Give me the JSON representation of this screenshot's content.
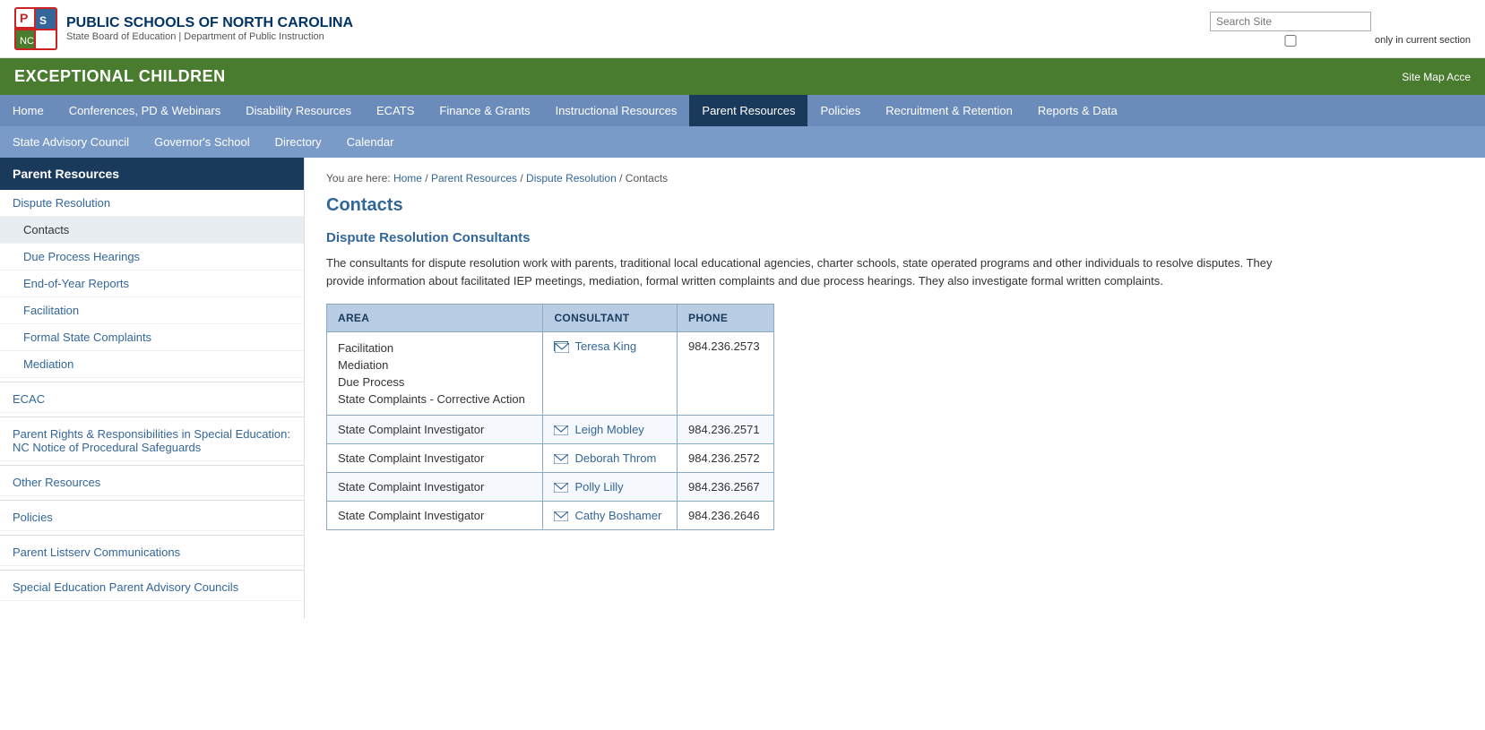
{
  "site": {
    "org_name": "PUBLIC SCHOOLS OF NORTH CAROLINA",
    "org_sub": "State Board of Education | Department of Public Instruction",
    "section": "EXCEPTIONAL CHILDREN",
    "banner_links": "Site Map  Acce"
  },
  "search": {
    "placeholder": "Search Site",
    "checkbox_label": "only in current section"
  },
  "nav": {
    "row1": [
      {
        "label": "Home",
        "active": false
      },
      {
        "label": "Conferences, PD & Webinars",
        "active": false
      },
      {
        "label": "Disability Resources",
        "active": false
      },
      {
        "label": "ECATS",
        "active": false
      },
      {
        "label": "Finance & Grants",
        "active": false
      },
      {
        "label": "Instructional Resources",
        "active": false
      },
      {
        "label": "Parent Resources",
        "active": true
      },
      {
        "label": "Policies",
        "active": false
      },
      {
        "label": "Recruitment & Retention",
        "active": false
      },
      {
        "label": "Reports & Data",
        "active": false
      }
    ],
    "row2": [
      {
        "label": "State Advisory Council",
        "active": false
      },
      {
        "label": "Governor's School",
        "active": false
      },
      {
        "label": "Directory",
        "active": false
      },
      {
        "label": "Calendar",
        "active": false
      }
    ]
  },
  "sidebar": {
    "title": "Parent Resources",
    "items": [
      {
        "label": "Dispute Resolution",
        "level": "top",
        "active": false
      },
      {
        "label": "Contacts",
        "level": "indented",
        "active": true
      },
      {
        "label": "Due Process Hearings",
        "level": "indented",
        "active": false
      },
      {
        "label": "End-of-Year Reports",
        "level": "indented",
        "active": false
      },
      {
        "label": "Facilitation",
        "level": "indented",
        "active": false
      },
      {
        "label": "Formal State Complaints",
        "level": "indented",
        "active": false
      },
      {
        "label": "Mediation",
        "level": "indented",
        "active": false
      },
      {
        "label": "ECAC",
        "level": "section",
        "active": false
      },
      {
        "label": "Parent Rights & Responsibilities in Special Education: NC Notice of Procedural Safeguards",
        "level": "top",
        "active": false
      },
      {
        "label": "Other Resources",
        "level": "top",
        "active": false
      },
      {
        "label": "Policies",
        "level": "top",
        "active": false
      },
      {
        "label": "Parent Listserv Communications",
        "level": "top",
        "active": false
      },
      {
        "label": "Special Education Parent Advisory Councils",
        "level": "top",
        "active": false
      }
    ]
  },
  "breadcrumb": {
    "items": [
      {
        "label": "Home",
        "link": true
      },
      {
        "label": "Parent Resources",
        "link": true
      },
      {
        "label": "Dispute Resolution",
        "link": true
      },
      {
        "label": "Contacts",
        "link": false
      }
    ]
  },
  "page": {
    "title": "Contacts",
    "section_title": "Dispute Resolution Consultants",
    "description": "The consultants for dispute resolution work with parents, traditional local educational agencies, charter schools, state operated programs and other individuals to resolve disputes.  They provide information about facilitated IEP meetings, mediation, formal written complaints and due process hearings.  They also investigate formal written complaints."
  },
  "table": {
    "headers": [
      "AREA",
      "CONSULTANT",
      "PHONE"
    ],
    "rows": [
      {
        "areas": [
          "Facilitation",
          "Mediation",
          "Due Process",
          "State Complaints - Corrective Action"
        ],
        "consultant": "Teresa King",
        "phone": "984.236.2573"
      },
      {
        "areas": [
          "State Complaint Investigator"
        ],
        "consultant": "Leigh Mobley",
        "phone": "984.236.2571"
      },
      {
        "areas": [
          "State Complaint Investigator"
        ],
        "consultant": "Deborah Throm",
        "phone": "984.236.2572"
      },
      {
        "areas": [
          "State Complaint Investigator"
        ],
        "consultant": "Polly Lilly",
        "phone": "984.236.2567"
      },
      {
        "areas": [
          "State Complaint Investigator"
        ],
        "consultant": "Cathy Boshamer",
        "phone": "984.236.2646"
      }
    ]
  }
}
